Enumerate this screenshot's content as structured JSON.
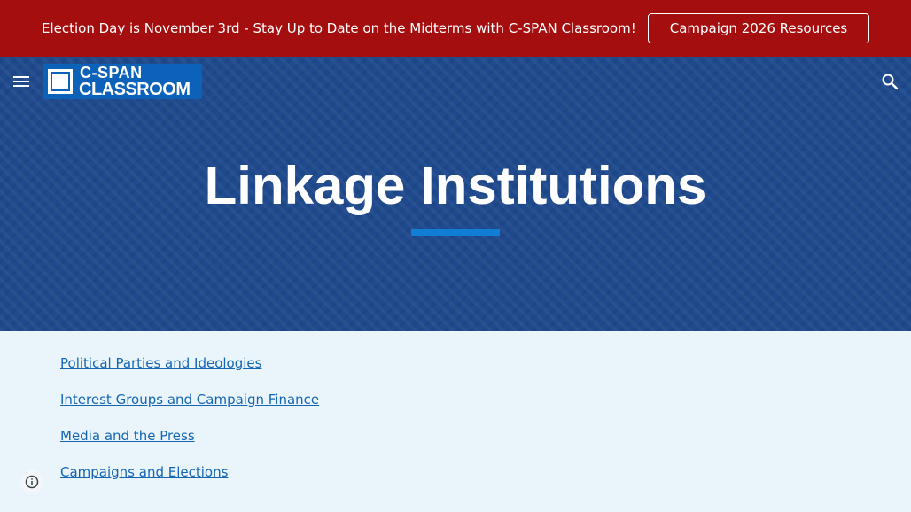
{
  "banner": {
    "message": "Election Day is November 3rd - Stay Up to Date on the Midterms with C-SPAN Classroom!",
    "button_label": "Campaign 2026 Resources"
  },
  "header": {
    "logo_top": "C-SPAN",
    "logo_bottom": "CLASSROOM"
  },
  "hero": {
    "title": "Linkage Institutions"
  },
  "links": [
    {
      "label": "Political Parties and Ideologies"
    },
    {
      "label": "Interest Groups and Campaign Finance"
    },
    {
      "label": "Media and the Press"
    },
    {
      "label": "Campaigns and Elections"
    }
  ],
  "colors": {
    "banner": "#a40e0f",
    "hero": "#1f4a8e",
    "accent": "#0f7ed4",
    "link": "#1565b5",
    "content_bg": "#eaf5fb"
  },
  "icons": [
    "menu-icon",
    "search-icon",
    "info-icon"
  ]
}
